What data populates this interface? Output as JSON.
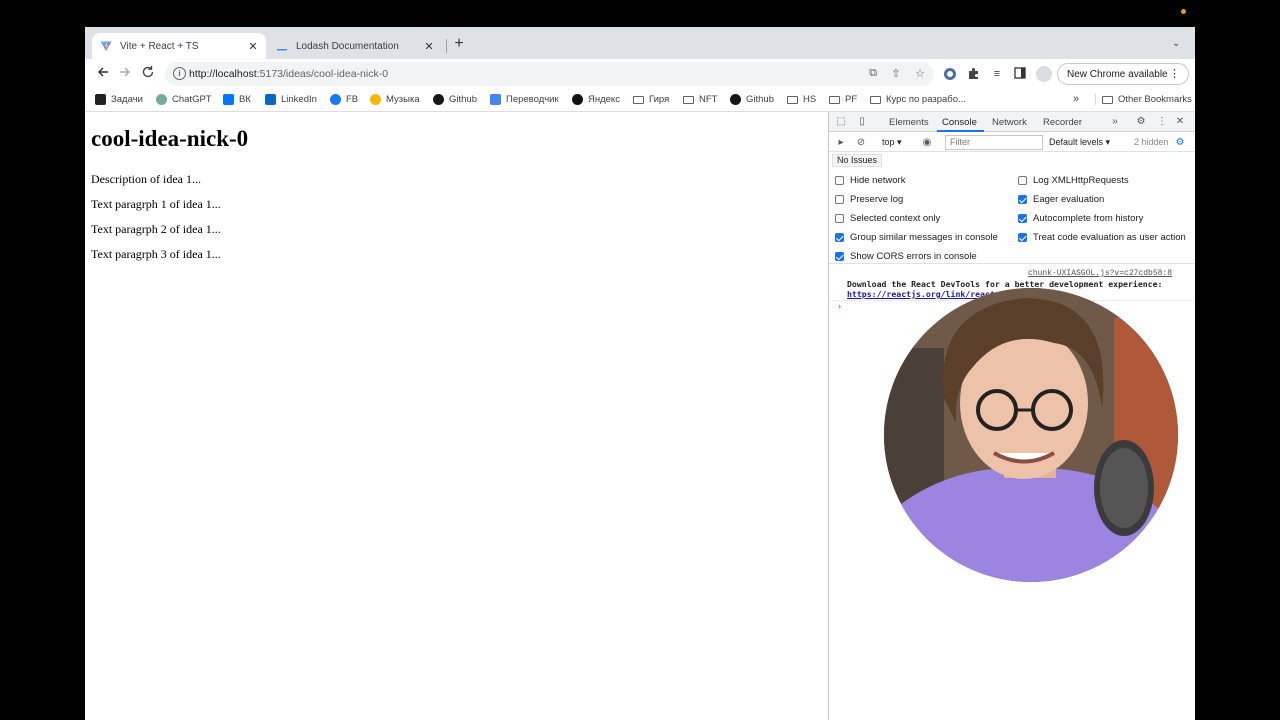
{
  "browser": {
    "tabs": [
      {
        "title": "Vite + React + TS",
        "icon": "vite-icon",
        "active": true
      },
      {
        "title": "Lodash Documentation",
        "icon": "lodash-icon",
        "active": false
      }
    ],
    "new_tab": "+",
    "tab_search": "⌄",
    "close": "✕",
    "url_host": "http://localhost",
    "url_rest": ":5173/ideas/cool-idea-nick-0",
    "update_button": "New Chrome available"
  },
  "bookmarks": [
    {
      "label": "Задачи",
      "icon": "tasks-icon"
    },
    {
      "label": "ChatGPT",
      "icon": "chatgpt-icon"
    },
    {
      "label": "ВК",
      "icon": "vk-icon"
    },
    {
      "label": "LinkedIn",
      "icon": "linkedin-icon"
    },
    {
      "label": "FB",
      "icon": "facebook-icon"
    },
    {
      "label": "Музыка",
      "icon": "music-icon"
    },
    {
      "label": "Github",
      "icon": "github-icon"
    },
    {
      "label": "Переводчик",
      "icon": "translate-icon"
    },
    {
      "label": "Яндекс",
      "icon": "yandex-icon"
    },
    {
      "label": "Гиря",
      "icon": "folder-icon"
    },
    {
      "label": "NFT",
      "icon": "folder-icon"
    },
    {
      "label": "Github",
      "icon": "github-icon"
    },
    {
      "label": "HS",
      "icon": "folder-icon"
    },
    {
      "label": "PF",
      "icon": "folder-icon"
    },
    {
      "label": "Курс по разрабо...",
      "icon": "folder-icon"
    },
    {
      "label": "Other Bookmarks",
      "icon": "folder-icon"
    }
  ],
  "page": {
    "title": "cool-idea-nick-0",
    "description": "Description of idea 1...",
    "paragraphs": [
      "Text paragrph 1 of idea 1...",
      "Text paragrph 2 of idea 1...",
      "Text paragrph 3 of idea 1..."
    ]
  },
  "devtools": {
    "tabs": [
      "Elements",
      "Console",
      "Network",
      "Recorder"
    ],
    "active_tab": "Console",
    "context": "top",
    "filter_placeholder": "Filter",
    "levels": "Default levels ▾",
    "hidden_count": "2 hidden",
    "issues": "No Issues",
    "settings_left": [
      {
        "label": "Hide network",
        "checked": false
      },
      {
        "label": "Preserve log",
        "checked": false
      },
      {
        "label": "Selected context only",
        "checked": false
      },
      {
        "label": "Group similar messages in console",
        "checked": true
      },
      {
        "label": "Show CORS errors in console",
        "checked": true
      }
    ],
    "settings_right": [
      {
        "label": "Log XMLHttpRequests",
        "checked": false
      },
      {
        "label": "Eager evaluation",
        "checked": true
      },
      {
        "label": "Autocomplete from history",
        "checked": true
      },
      {
        "label": "Treat code evaluation as user action",
        "checked": true
      }
    ],
    "console_source": "chunk-UXIASGOL.js?v=c27cdb58:8",
    "console_message": "Download the React DevTools for a better development experience: ",
    "console_link": "https://reactjs.org/link/react-devtools"
  },
  "colors": {
    "accent": "#1a73e8",
    "tab_strip": "#dee1e6",
    "webcam_shirt": "#9b85e0"
  }
}
